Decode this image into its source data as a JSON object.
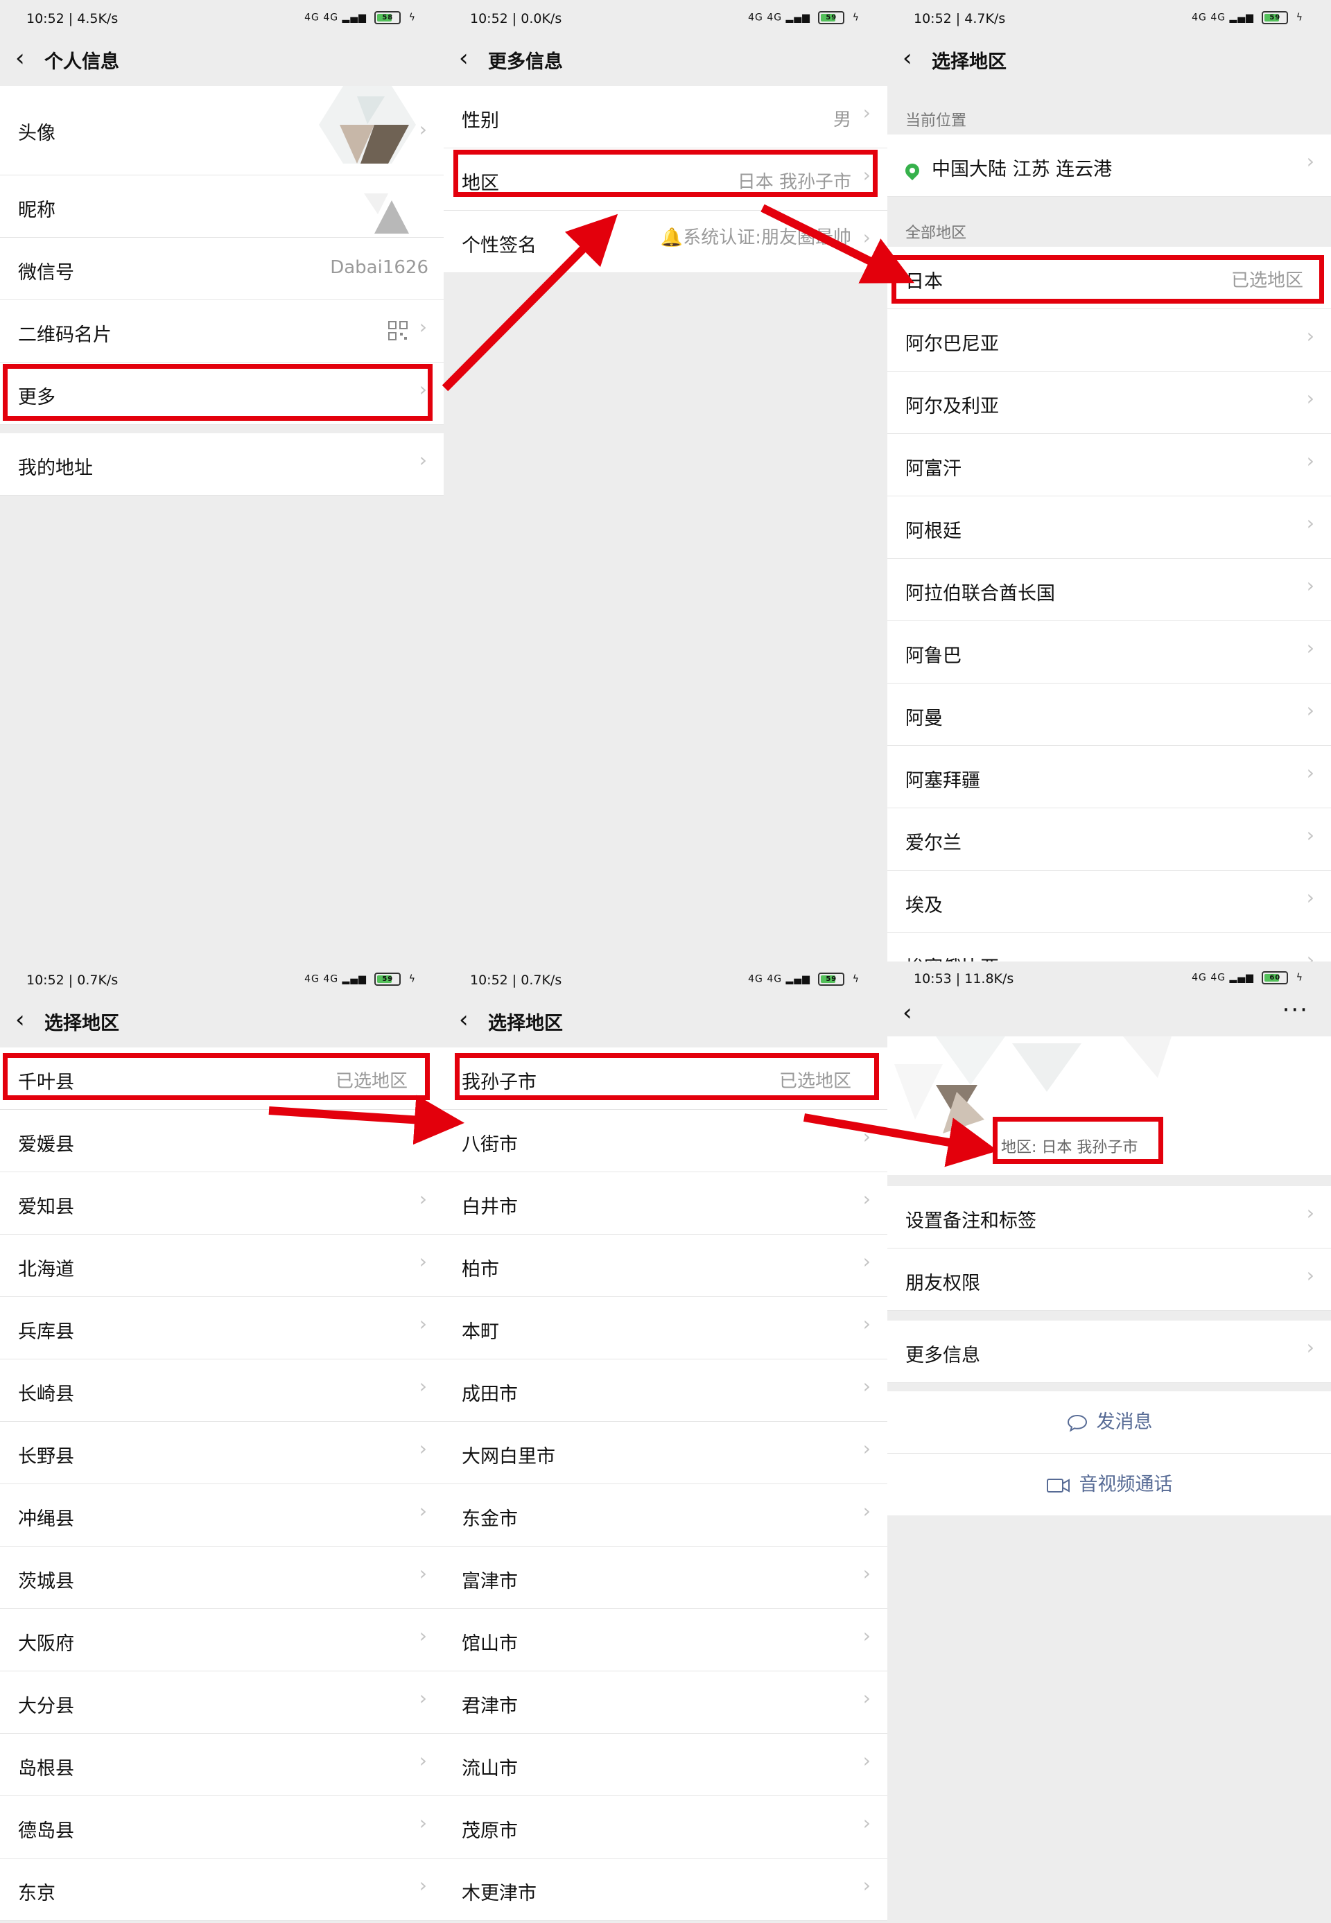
{
  "status": {
    "p1": "10:52 | 4.5K/s",
    "p2": "10:52 | 0.0K/s",
    "p3": "10:52 | 4.7K/s",
    "p4": "10:52 | 0.7K/s",
    "p5": "10:52 | 0.7K/s",
    "p6": "10:53 | 11.8K/s",
    "net": "4G 4G",
    "batt": {
      "p1": "58",
      "p2": "59",
      "p3": "59",
      "p4": "59",
      "p5": "59",
      "p6": "60"
    }
  },
  "p1": {
    "title": "个人信息",
    "rows": [
      {
        "label": "头像"
      },
      {
        "label": "昵称"
      },
      {
        "label": "微信号",
        "value": "Dabai1626"
      },
      {
        "label": "二维码名片"
      },
      {
        "label": "更多"
      },
      {
        "label": "我的地址"
      }
    ]
  },
  "p2": {
    "title": "更多信息",
    "rows": [
      {
        "label": "性别",
        "value": "男"
      },
      {
        "label": "地区",
        "value": "日本 我孙子市"
      },
      {
        "label": "个性签名",
        "value": "🔔系统认证:朋友圈最帅"
      }
    ]
  },
  "p3": {
    "title": "选择地区",
    "current_label": "当前位置",
    "current_value": "中国大陆 江苏 连云港",
    "all_label": "全部地区",
    "selected": {
      "label": "日本",
      "value": "已选地区"
    },
    "items": [
      "阿尔巴尼亚",
      "阿尔及利亚",
      "阿富汗",
      "阿根廷",
      "阿拉伯联合酋长国",
      "阿鲁巴",
      "阿曼",
      "阿塞拜疆",
      "爱尔兰",
      "埃及",
      "埃塞俄比亚"
    ]
  },
  "p4": {
    "title": "选择地区",
    "selected": {
      "label": "千叶县",
      "value": "已选地区"
    },
    "items": [
      "爱媛县",
      "爱知县",
      "北海道",
      "兵库县",
      "长崎县",
      "长野县",
      "冲绳县",
      "茨城县",
      "大阪府",
      "大分县",
      "岛根县",
      "德岛县",
      "东京"
    ]
  },
  "p5": {
    "title": "选择地区",
    "selected": {
      "label": "我孙子市",
      "value": "已选地区"
    },
    "items": [
      "八街市",
      "白井市",
      "柏市",
      "本町",
      "成田市",
      "大网白里市",
      "东金市",
      "富津市",
      "馆山市",
      "君津市",
      "流山市",
      "茂原市",
      "木更津市"
    ]
  },
  "p6": {
    "region": "地区:  日本  我孙子市",
    "rows": [
      {
        "label": "设置备注和标签"
      },
      {
        "label": "朋友权限"
      },
      {
        "label": "更多信息"
      }
    ],
    "send_message": "发消息",
    "video_call": "音视频通话"
  },
  "icons": {
    "back": "chevron-left-icon",
    "chevron": "chevron-right-icon",
    "qr": "qr-code-icon",
    "location": "location-pin-icon",
    "chat": "chat-bubble-icon",
    "video": "video-camera-icon",
    "more": "more-dots-icon"
  },
  "colors": {
    "highlight": "#e3000c",
    "link": "#576b95",
    "pin": "#36b14b",
    "battery": "#53c05a"
  }
}
